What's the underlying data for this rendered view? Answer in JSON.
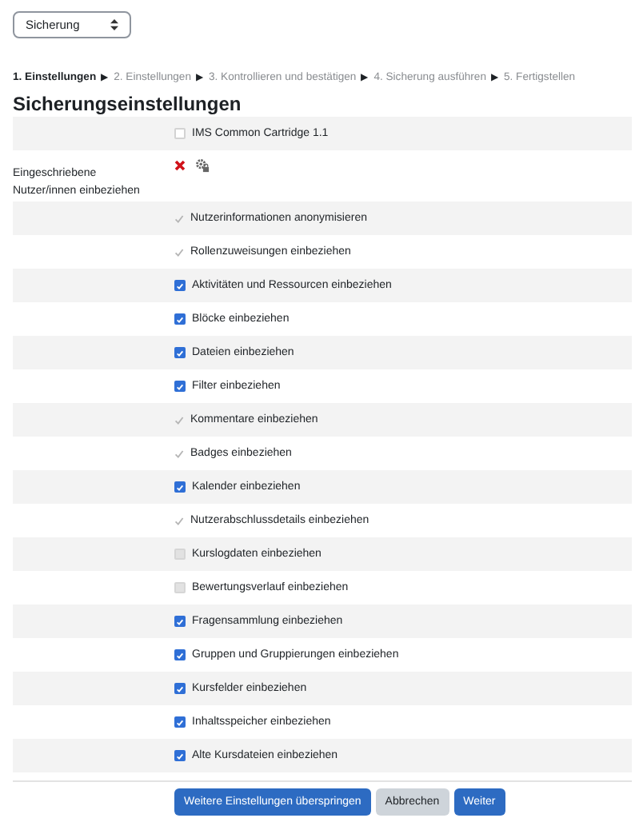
{
  "menu_select": {
    "value": "Sicherung"
  },
  "steps": [
    {
      "label": "1. Einstellungen",
      "selected": true,
      "arrow": "▶"
    },
    {
      "label": "2. Einstellungen",
      "selected": false,
      "arrow": "▶"
    },
    {
      "label": "3. Kontrollieren und bestätigen",
      "selected": false,
      "arrow": "▶"
    },
    {
      "label": "4. Sicherung ausführen",
      "selected": false,
      "arrow": "▶"
    },
    {
      "label": "5. Fertigstellen",
      "selected": false
    }
  ],
  "heading": "Sicherungseinstellungen",
  "settings": [
    {
      "kind": "checkbox",
      "label": "IMS Common Cartridge 1.1",
      "checked": false,
      "disabled": false
    },
    {
      "kind": "locked",
      "label": "Eingeschriebene Nutzer/innen einbeziehen",
      "checked": false
    },
    {
      "kind": "checkbox",
      "label": "Nutzerinformationen anonymisieren",
      "checked": true,
      "disabled": true
    },
    {
      "kind": "checkbox",
      "label": "Rollenzuweisungen einbeziehen",
      "checked": true,
      "disabled": true
    },
    {
      "kind": "checkbox",
      "label": "Aktivitäten und Ressourcen einbeziehen",
      "checked": true,
      "disabled": false
    },
    {
      "kind": "checkbox",
      "label": "Blöcke einbeziehen",
      "checked": true,
      "disabled": false
    },
    {
      "kind": "checkbox",
      "label": "Dateien einbeziehen",
      "checked": true,
      "disabled": false
    },
    {
      "kind": "checkbox",
      "label": "Filter einbeziehen",
      "checked": true,
      "disabled": false
    },
    {
      "kind": "checkbox",
      "label": "Kommentare einbeziehen",
      "checked": true,
      "disabled": true
    },
    {
      "kind": "checkbox",
      "label": "Badges einbeziehen",
      "checked": true,
      "disabled": true
    },
    {
      "kind": "checkbox",
      "label": "Kalender einbeziehen",
      "checked": true,
      "disabled": false
    },
    {
      "kind": "checkbox",
      "label": "Nutzerabschlussdetails einbeziehen",
      "checked": true,
      "disabled": true
    },
    {
      "kind": "checkbox",
      "label": "Kurslogdaten einbeziehen",
      "checked": false,
      "disabled": true
    },
    {
      "kind": "checkbox",
      "label": "Bewertungsverlauf einbeziehen",
      "checked": false,
      "disabled": true
    },
    {
      "kind": "checkbox",
      "label": "Fragensammlung einbeziehen",
      "checked": true,
      "disabled": false
    },
    {
      "kind": "checkbox",
      "label": "Gruppen und Gruppierungen einbeziehen",
      "checked": true,
      "disabled": false
    },
    {
      "kind": "checkbox",
      "label": "Kursfelder einbeziehen",
      "checked": true,
      "disabled": false
    },
    {
      "kind": "checkbox",
      "label": "Inhaltsspeicher einbeziehen",
      "checked": true,
      "disabled": false
    },
    {
      "kind": "checkbox",
      "label": "Alte Kursdateien einbeziehen",
      "checked": true,
      "disabled": false
    }
  ],
  "buttons": [
    {
      "label": "Weitere Einstellungen überspringen",
      "kind": "primary"
    },
    {
      "label": "Abbrechen",
      "kind": "secondary"
    },
    {
      "label": "Weiter",
      "kind": "primary"
    }
  ]
}
